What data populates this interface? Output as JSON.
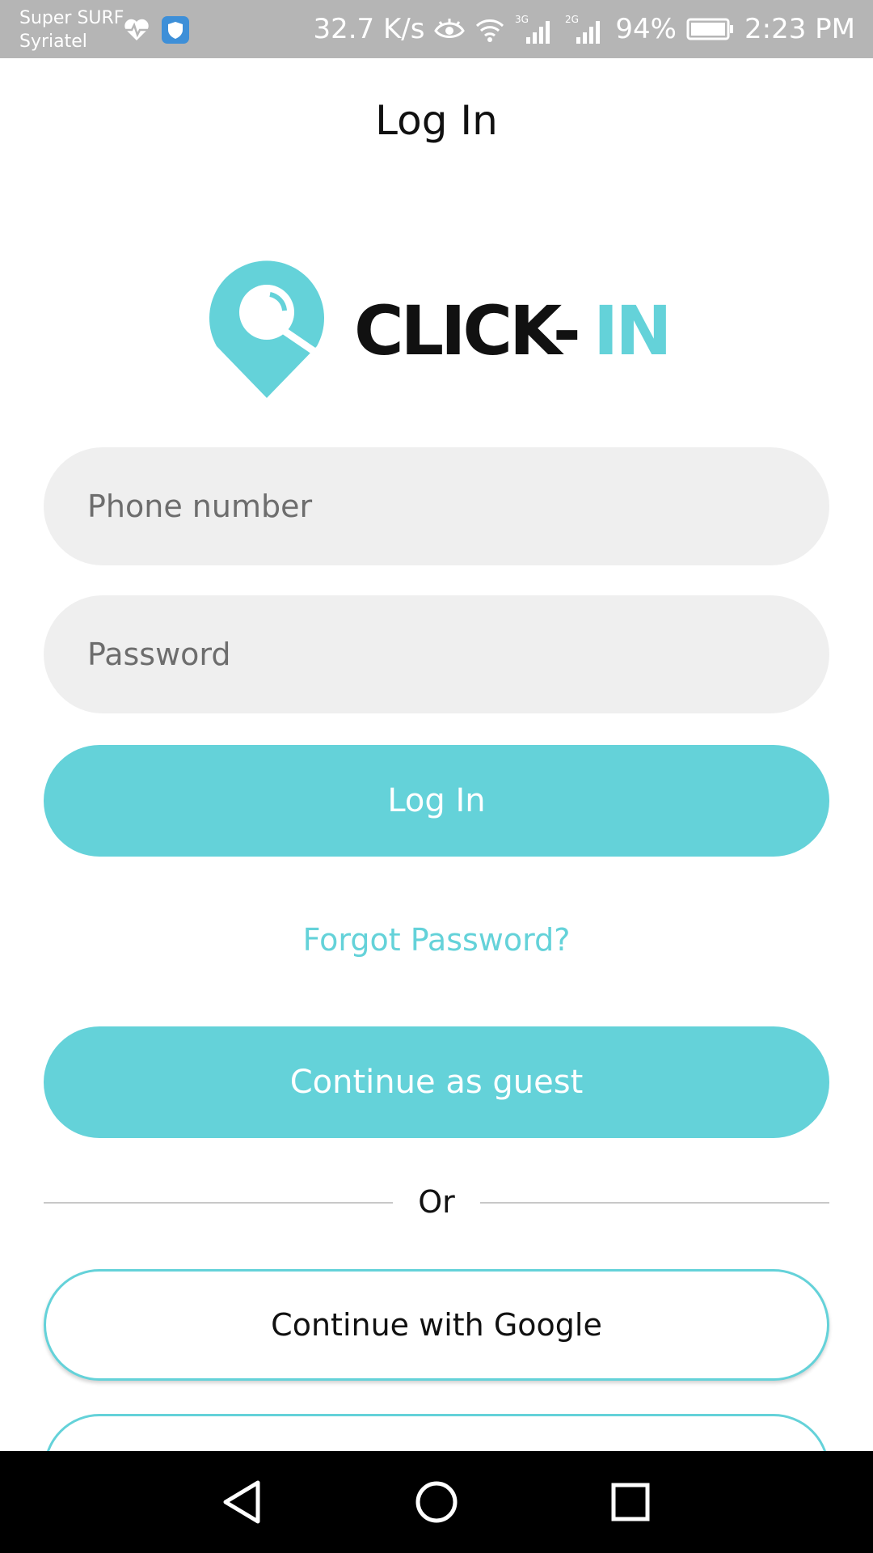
{
  "status_bar": {
    "carrier_line1": "Super SURF",
    "carrier_line2": "Syriatel",
    "speed": "32.7 K/s",
    "net1": "3G",
    "net2": "2G",
    "battery": "94%",
    "time": "2:23 PM",
    "icons": [
      "heartbeat-icon",
      "shield-icon",
      "eye-icon",
      "wifi-icon",
      "signal-icon",
      "signal-icon",
      "battery-icon"
    ]
  },
  "header": {
    "title": "Log In"
  },
  "logo": {
    "text_dark": "CLICK-",
    "text_accent": "IN",
    "icon": "location-search-pin-icon"
  },
  "form": {
    "phone_placeholder": "Phone number",
    "password_placeholder": "Password",
    "login_label": "Log In",
    "forgot_label": "Forgot Password?",
    "guest_label": "Continue as guest",
    "or_label": "Or",
    "google_label": "Continue with Google"
  },
  "nav_bar": {
    "icons": [
      "back-icon",
      "home-icon",
      "recents-icon"
    ]
  },
  "colors": {
    "accent": "#64d2d9",
    "field_bg": "#efefef",
    "status_bar": "#b5b5b5",
    "text": "#111111"
  }
}
